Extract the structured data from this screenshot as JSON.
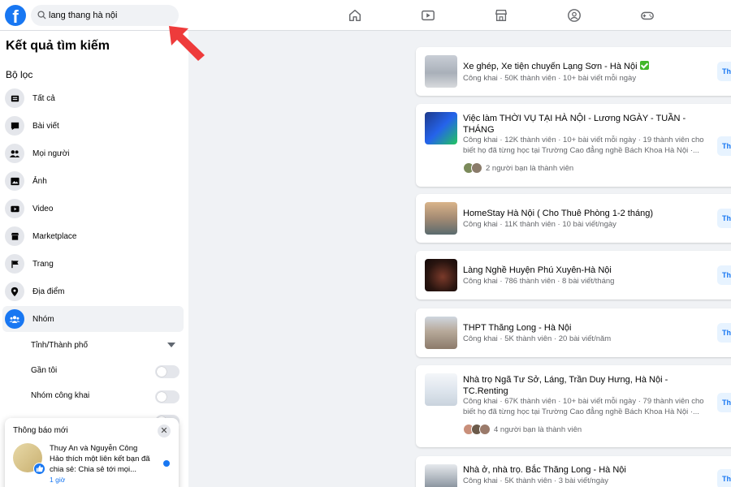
{
  "topbar": {
    "logo_letter": "f",
    "search_value": "lang thang hà nội",
    "nav_icons": [
      "home-icon",
      "video-icon",
      "marketplace-icon",
      "groups-icon",
      "gaming-icon"
    ]
  },
  "sidebar": {
    "title": "Kết quả tìm kiếm",
    "filter_heading": "Bộ lọc",
    "items": [
      {
        "label": "Tất cả",
        "icon": "all-icon"
      },
      {
        "label": "Bài viết",
        "icon": "posts-icon"
      },
      {
        "label": "Mọi người",
        "icon": "people-icon"
      },
      {
        "label": "Ảnh",
        "icon": "photo-icon"
      },
      {
        "label": "Video",
        "icon": "video-icon"
      },
      {
        "label": "Marketplace",
        "icon": "marketplace-icon"
      },
      {
        "label": "Trang",
        "icon": "flag-icon"
      },
      {
        "label": "Địa điểm",
        "icon": "location-icon"
      },
      {
        "label": "Nhóm",
        "icon": "groups-icon",
        "active": true
      }
    ],
    "sub_filters": {
      "city": "Tỉnh/Thành phố",
      "near_me": "Gần tôi",
      "public_groups": "Nhóm công khai"
    }
  },
  "notification": {
    "title": "Thông báo mới",
    "name1": "Thuy An",
    "conj": "và",
    "name2": "Nguyễn Công Hảo",
    "text": "thích một liên kết bạn đã chia sẻ: Chia sẻ tới mọi...",
    "time": "1 giờ"
  },
  "results": [
    {
      "title": "Xe ghép, Xe tiện chuyến Lạng Sơn - Hà Nội",
      "meta": "Công khai · 50K thành viên · 10+ bài viết mỗi ngày",
      "verified": true
    },
    {
      "title": "Việc làm THỜI VỤ TẠI HÀ NỘI - Lương NGÀY - TUẦN - THÁNG",
      "meta": "Công khai · 12K thành viên · 10+ bài viết mỗi ngày · 19 thành viên cho biết họ đã từng học tại Trường Cao đẳng nghề Bách Khoa Hà Nội ·...",
      "friends": "2 người bạn là thành viên"
    },
    {
      "title": "HomeStay Hà Nội ( Cho Thuê Phòng 1-2 tháng)",
      "meta": "Công khai · 11K thành viên · 10 bài viết/ngày"
    },
    {
      "title": "Làng Nghề Huyện Phú Xuyên-Hà Nội",
      "meta": "Công khai · 786 thành viên · 8 bài viết/tháng"
    },
    {
      "title": "THPT Thăng Long - Hà Nội",
      "meta": "Công khai · 5K thành viên · 20 bài viết/năm"
    },
    {
      "title": "Nhà trọ Ngã Tư Sở, Láng, Trần Duy Hưng, Hà Nội - TC.Renting",
      "meta": "Công khai · 67K thành viên · 10+ bài viết mỗi ngày · 79 thành viên cho biết họ đã từng học tại Trường Cao đẳng nghề Bách Khoa Hà Nội ·...",
      "friends": "4 người bạn là thành viên"
    },
    {
      "title": "Nhà ở, nhà trọ. Bắc Thăng Long - Hà Nội",
      "meta": "Công khai · 5K thành viên · 3 bài viết/ngày"
    }
  ],
  "join_label": "Th",
  "colors": {
    "brand": "#1877f2",
    "annotation_arrow": "#ee3b3b",
    "verified": "#42b72a"
  }
}
